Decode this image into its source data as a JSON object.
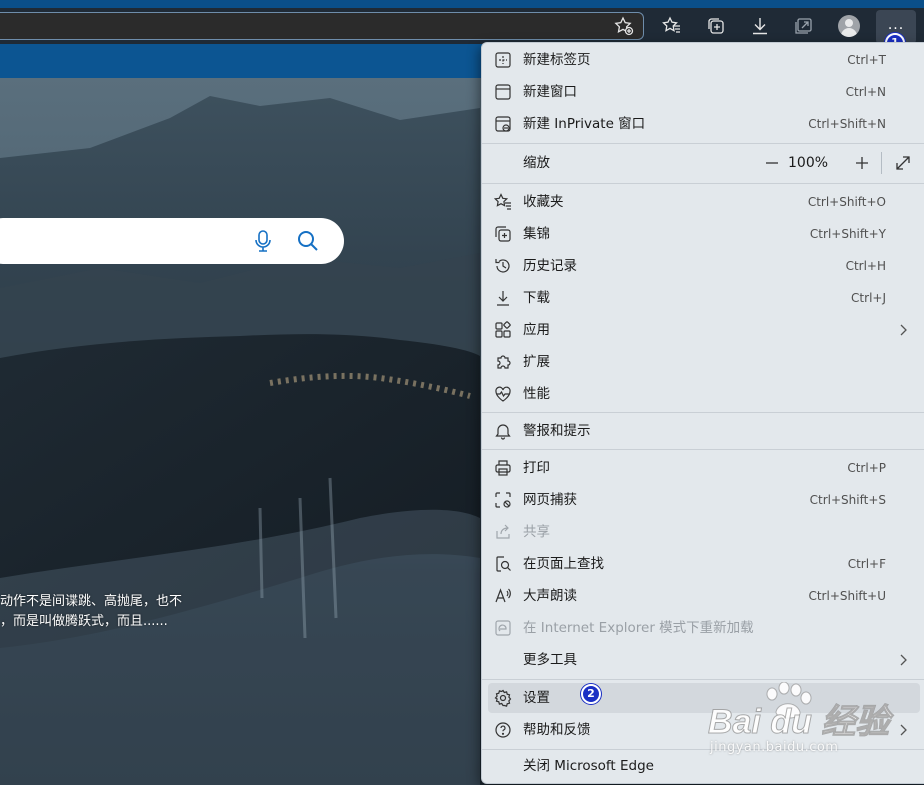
{
  "menu": {
    "items": [
      {
        "label": "新建标签页",
        "shortcut": "Ctrl+T",
        "icon": "new-tab-icon"
      },
      {
        "label": "新建窗口",
        "shortcut": "Ctrl+N",
        "icon": "new-window-icon"
      },
      {
        "label": "新建 InPrivate 窗口",
        "shortcut": "Ctrl+Shift+N",
        "icon": "inprivate-icon"
      },
      {
        "label": "缩放",
        "zoom_value": "100%",
        "icon": ""
      },
      {
        "label": "收藏夹",
        "shortcut": "Ctrl+Shift+O",
        "icon": "favorites-icon"
      },
      {
        "label": "集锦",
        "shortcut": "Ctrl+Shift+Y",
        "icon": "collections-icon"
      },
      {
        "label": "历史记录",
        "shortcut": "Ctrl+H",
        "icon": "history-icon"
      },
      {
        "label": "下载",
        "shortcut": "Ctrl+J",
        "icon": "download-icon"
      },
      {
        "label": "应用",
        "shortcut": "",
        "icon": "apps-icon"
      },
      {
        "label": "扩展",
        "shortcut": "",
        "icon": "extensions-icon"
      },
      {
        "label": "性能",
        "shortcut": "",
        "icon": "performance-icon"
      },
      {
        "label": "警报和提示",
        "shortcut": "",
        "icon": "bell-icon"
      },
      {
        "label": "打印",
        "shortcut": "Ctrl+P",
        "icon": "print-icon"
      },
      {
        "label": "网页捕获",
        "shortcut": "Ctrl+Shift+S",
        "icon": "web-capture-icon"
      },
      {
        "label": "共享",
        "shortcut": "",
        "icon": "share-icon"
      },
      {
        "label": "在页面上查找",
        "shortcut": "Ctrl+F",
        "icon": "find-icon"
      },
      {
        "label": "大声朗读",
        "shortcut": "Ctrl+Shift+U",
        "icon": "read-aloud-icon"
      },
      {
        "label": "在 Internet Explorer 模式下重新加载",
        "shortcut": "",
        "icon": "ie-mode-icon"
      },
      {
        "label": "更多工具",
        "shortcut": "",
        "icon": ""
      },
      {
        "label": "设置",
        "shortcut": "",
        "icon": "gear-icon"
      },
      {
        "label": "帮助和反馈",
        "shortcut": "",
        "icon": "help-icon"
      },
      {
        "label": "关闭 Microsoft Edge",
        "shortcut": "",
        "icon": ""
      }
    ]
  },
  "toolbar": {
    "more_label": "...",
    "badge1": "1",
    "badge2": "2"
  },
  "page": {
    "caption_line1": "动作不是间谍跳、高抛尾，也不",
    "caption_line2": "，而是叫做腾跃式，而且......"
  },
  "watermark": {
    "brand": "Bai du 经验",
    "url": "jingyan.baidu.com"
  },
  "colors": {
    "accent": "#0c5592",
    "menu_bg": "#e3e8ec",
    "badge": "#1a2fc4"
  }
}
